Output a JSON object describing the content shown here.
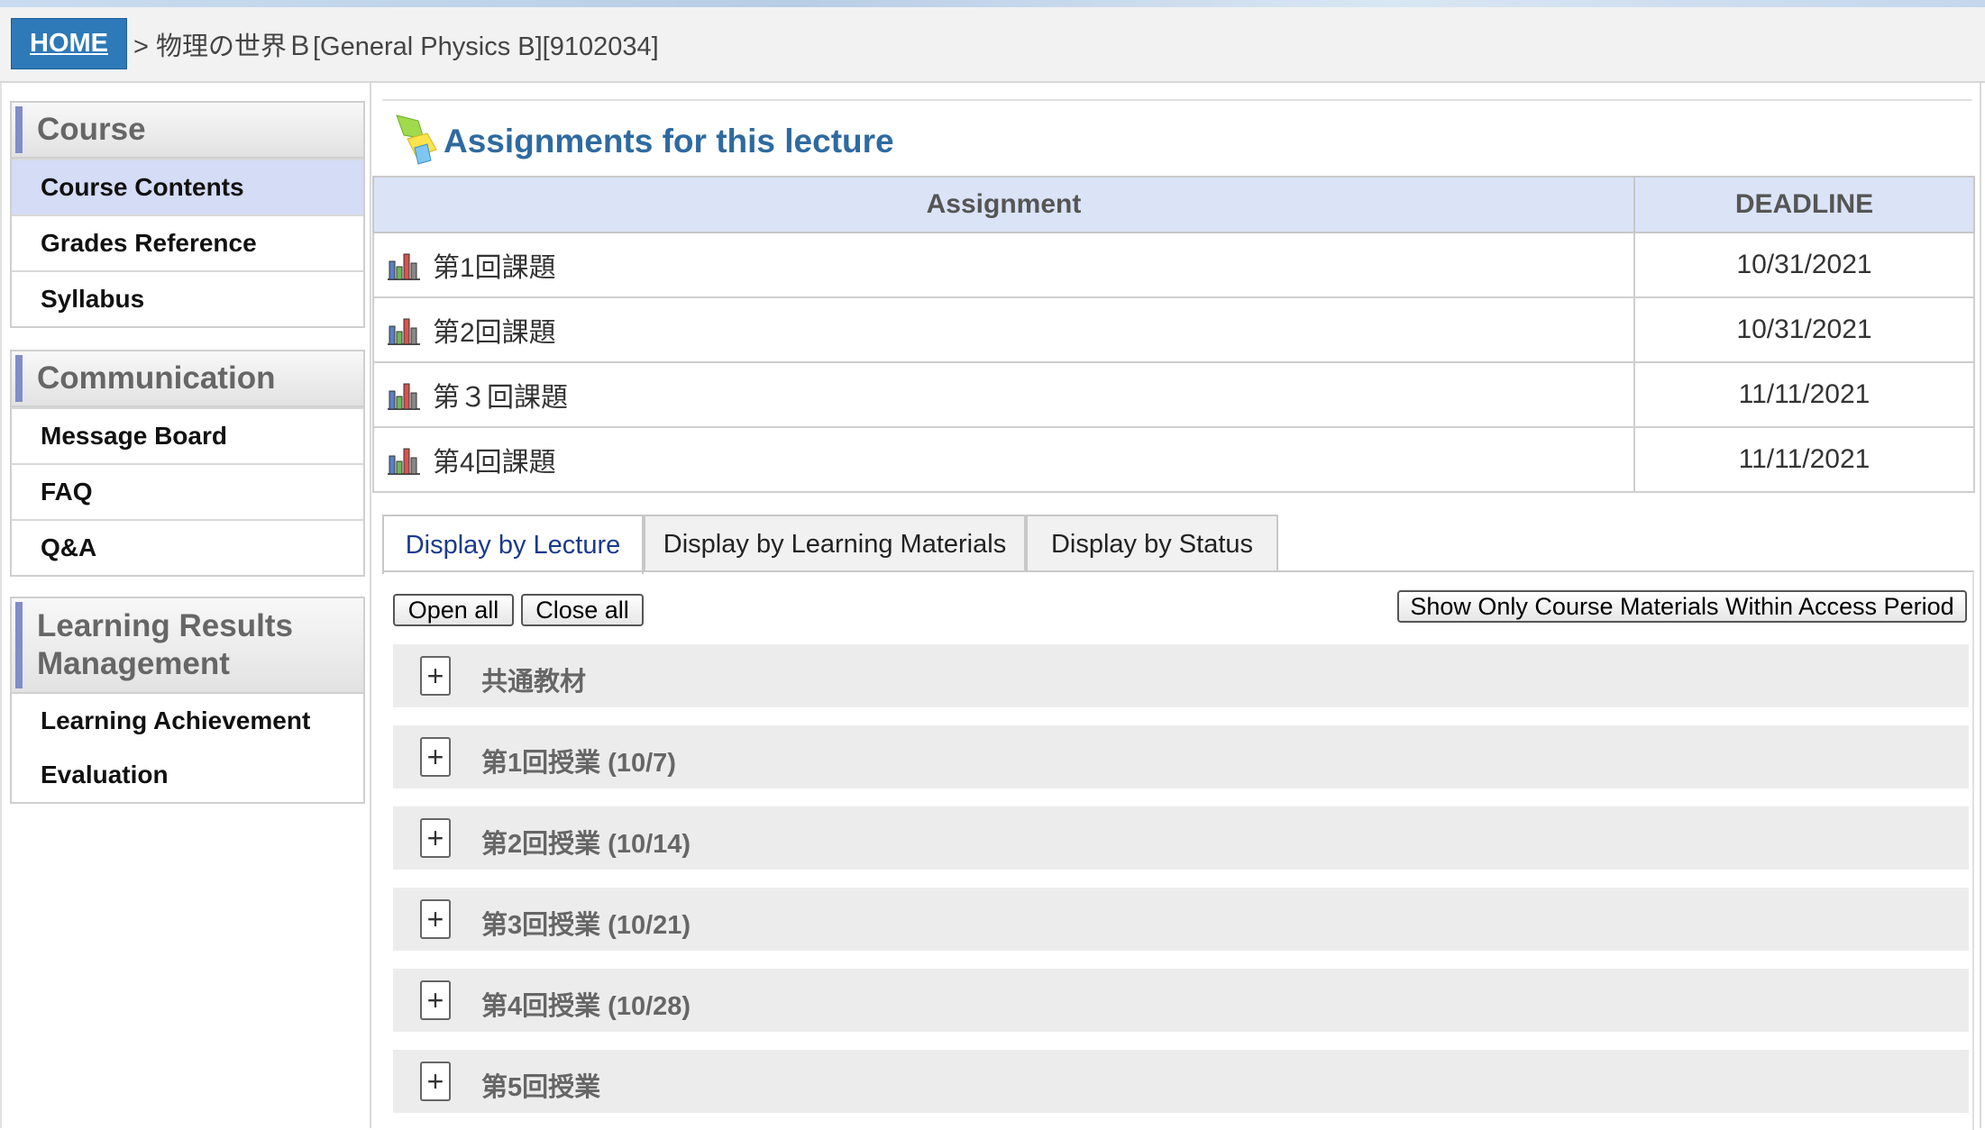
{
  "breadcrumb": {
    "home_label": "HOME",
    "path_text": "> 物理の世界Ｂ[General Physics B][9102034]"
  },
  "sidebar": {
    "course": {
      "title": "Course",
      "items": [
        {
          "label": "Course Contents",
          "active": true
        },
        {
          "label": "Grades Reference"
        },
        {
          "label": "Syllabus"
        }
      ]
    },
    "communication": {
      "title": "Communication",
      "items": [
        {
          "label": "Message Board"
        },
        {
          "label": "FAQ"
        },
        {
          "label": "Q&A"
        }
      ]
    },
    "learning": {
      "title_line1": "Learning Results",
      "title_line2": "Management",
      "items": [
        {
          "label": "Learning Achievement"
        },
        {
          "label": "Evaluation"
        }
      ]
    }
  },
  "assignments": {
    "title": "Assignments for this lecture",
    "col_assignment": "Assignment",
    "col_deadline": "DEADLINE",
    "rows": [
      {
        "name": "第1回課題",
        "deadline": "10/31/2021",
        "icon": "bar-chart-icon"
      },
      {
        "name": "第2回課題",
        "deadline": "10/31/2021",
        "icon": "bar-chart-icon"
      },
      {
        "name": "第３回課題",
        "deadline": "11/11/2021",
        "icon": "bar-chart-icon"
      },
      {
        "name": "第4回課題",
        "deadline": "11/11/2021",
        "icon": "bar-chart-icon"
      }
    ]
  },
  "tabs": [
    {
      "label": "Display by Lecture",
      "active": true
    },
    {
      "label": "Display by Learning Materials"
    },
    {
      "label": "Display by Status"
    }
  ],
  "controls": {
    "open_all": "Open all",
    "close_all": "Close all",
    "access_period": "Show Only Course Materials Within Access Period"
  },
  "sections": [
    {
      "label": "共通教材",
      "toggle": "+"
    },
    {
      "label": "第1回授業 (10/7)",
      "toggle": "+"
    },
    {
      "label": "第2回授業 (10/14)",
      "toggle": "+"
    },
    {
      "label": "第3回授業 (10/21)",
      "toggle": "+"
    },
    {
      "label": "第4回授業 (10/28)",
      "toggle": "+"
    },
    {
      "label": "第5回授業",
      "toggle": "+"
    }
  ],
  "colors": {
    "home_bg": "#2e79b8",
    "title_blue": "#2e6aa0",
    "active_item_bg": "#d4dcf6",
    "table_header_bg": "#dbe4f7",
    "section_bg": "#ececec"
  }
}
